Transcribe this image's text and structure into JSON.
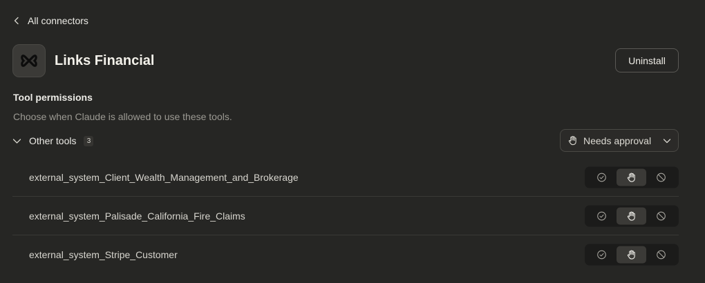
{
  "nav": {
    "back_label": "All connectors"
  },
  "connector": {
    "name": "Links Financial",
    "uninstall_label": "Uninstall"
  },
  "permissions": {
    "title": "Tool permissions",
    "subtitle": "Choose when Claude is allowed to use these tools."
  },
  "group": {
    "label": "Other tools",
    "count": "3",
    "policy_value": "Needs approval"
  },
  "tools": [
    {
      "name": "external_system_Client_Wealth_Management_and_Brokerage",
      "selected": "needs-approval"
    },
    {
      "name": "external_system_Palisade_California_Fire_Claims",
      "selected": "needs-approval"
    },
    {
      "name": "external_system_Stripe_Customer",
      "selected": "needs-approval"
    }
  ],
  "colors": {
    "background": "#262624",
    "text": "#ecebe6",
    "muted": "#9c9a93",
    "segment_active": "#3b3a37",
    "segment_bg": "#1b1b1a"
  },
  "icons": {
    "back": "chevron-left-icon",
    "logo": "links-financial-logo-icon",
    "group_toggle": "chevron-down-icon",
    "policy": "hand-icon",
    "select": "chevron-down-icon",
    "allow": "check-circle-icon",
    "approval": "hand-icon",
    "block": "block-icon"
  }
}
